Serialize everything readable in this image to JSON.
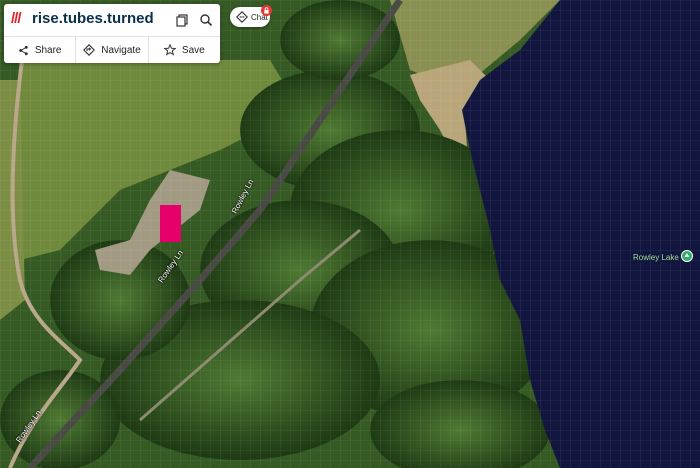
{
  "w3w": {
    "slashes": "///",
    "address": "rise.tubes.turned",
    "copy_icon": "copy-icon",
    "search_icon": "search-icon"
  },
  "actions": [
    {
      "label": "Share",
      "icon": "share-icon"
    },
    {
      "label": "Navigate",
      "icon": "navigate-icon"
    },
    {
      "label": "Save",
      "icon": "star-icon"
    }
  ],
  "chat": {
    "label": "Chat",
    "icon": "chat-icon",
    "badge_icon": "lock-icon"
  },
  "map": {
    "poi_label": "Rowley Lake",
    "road_labels": [
      "Rowley Ln",
      "Rowley Ln",
      "Rowley Ln"
    ],
    "colors": {
      "selected_square": "#e5006a",
      "water": "#12163f",
      "grid": "#ffffff"
    }
  }
}
